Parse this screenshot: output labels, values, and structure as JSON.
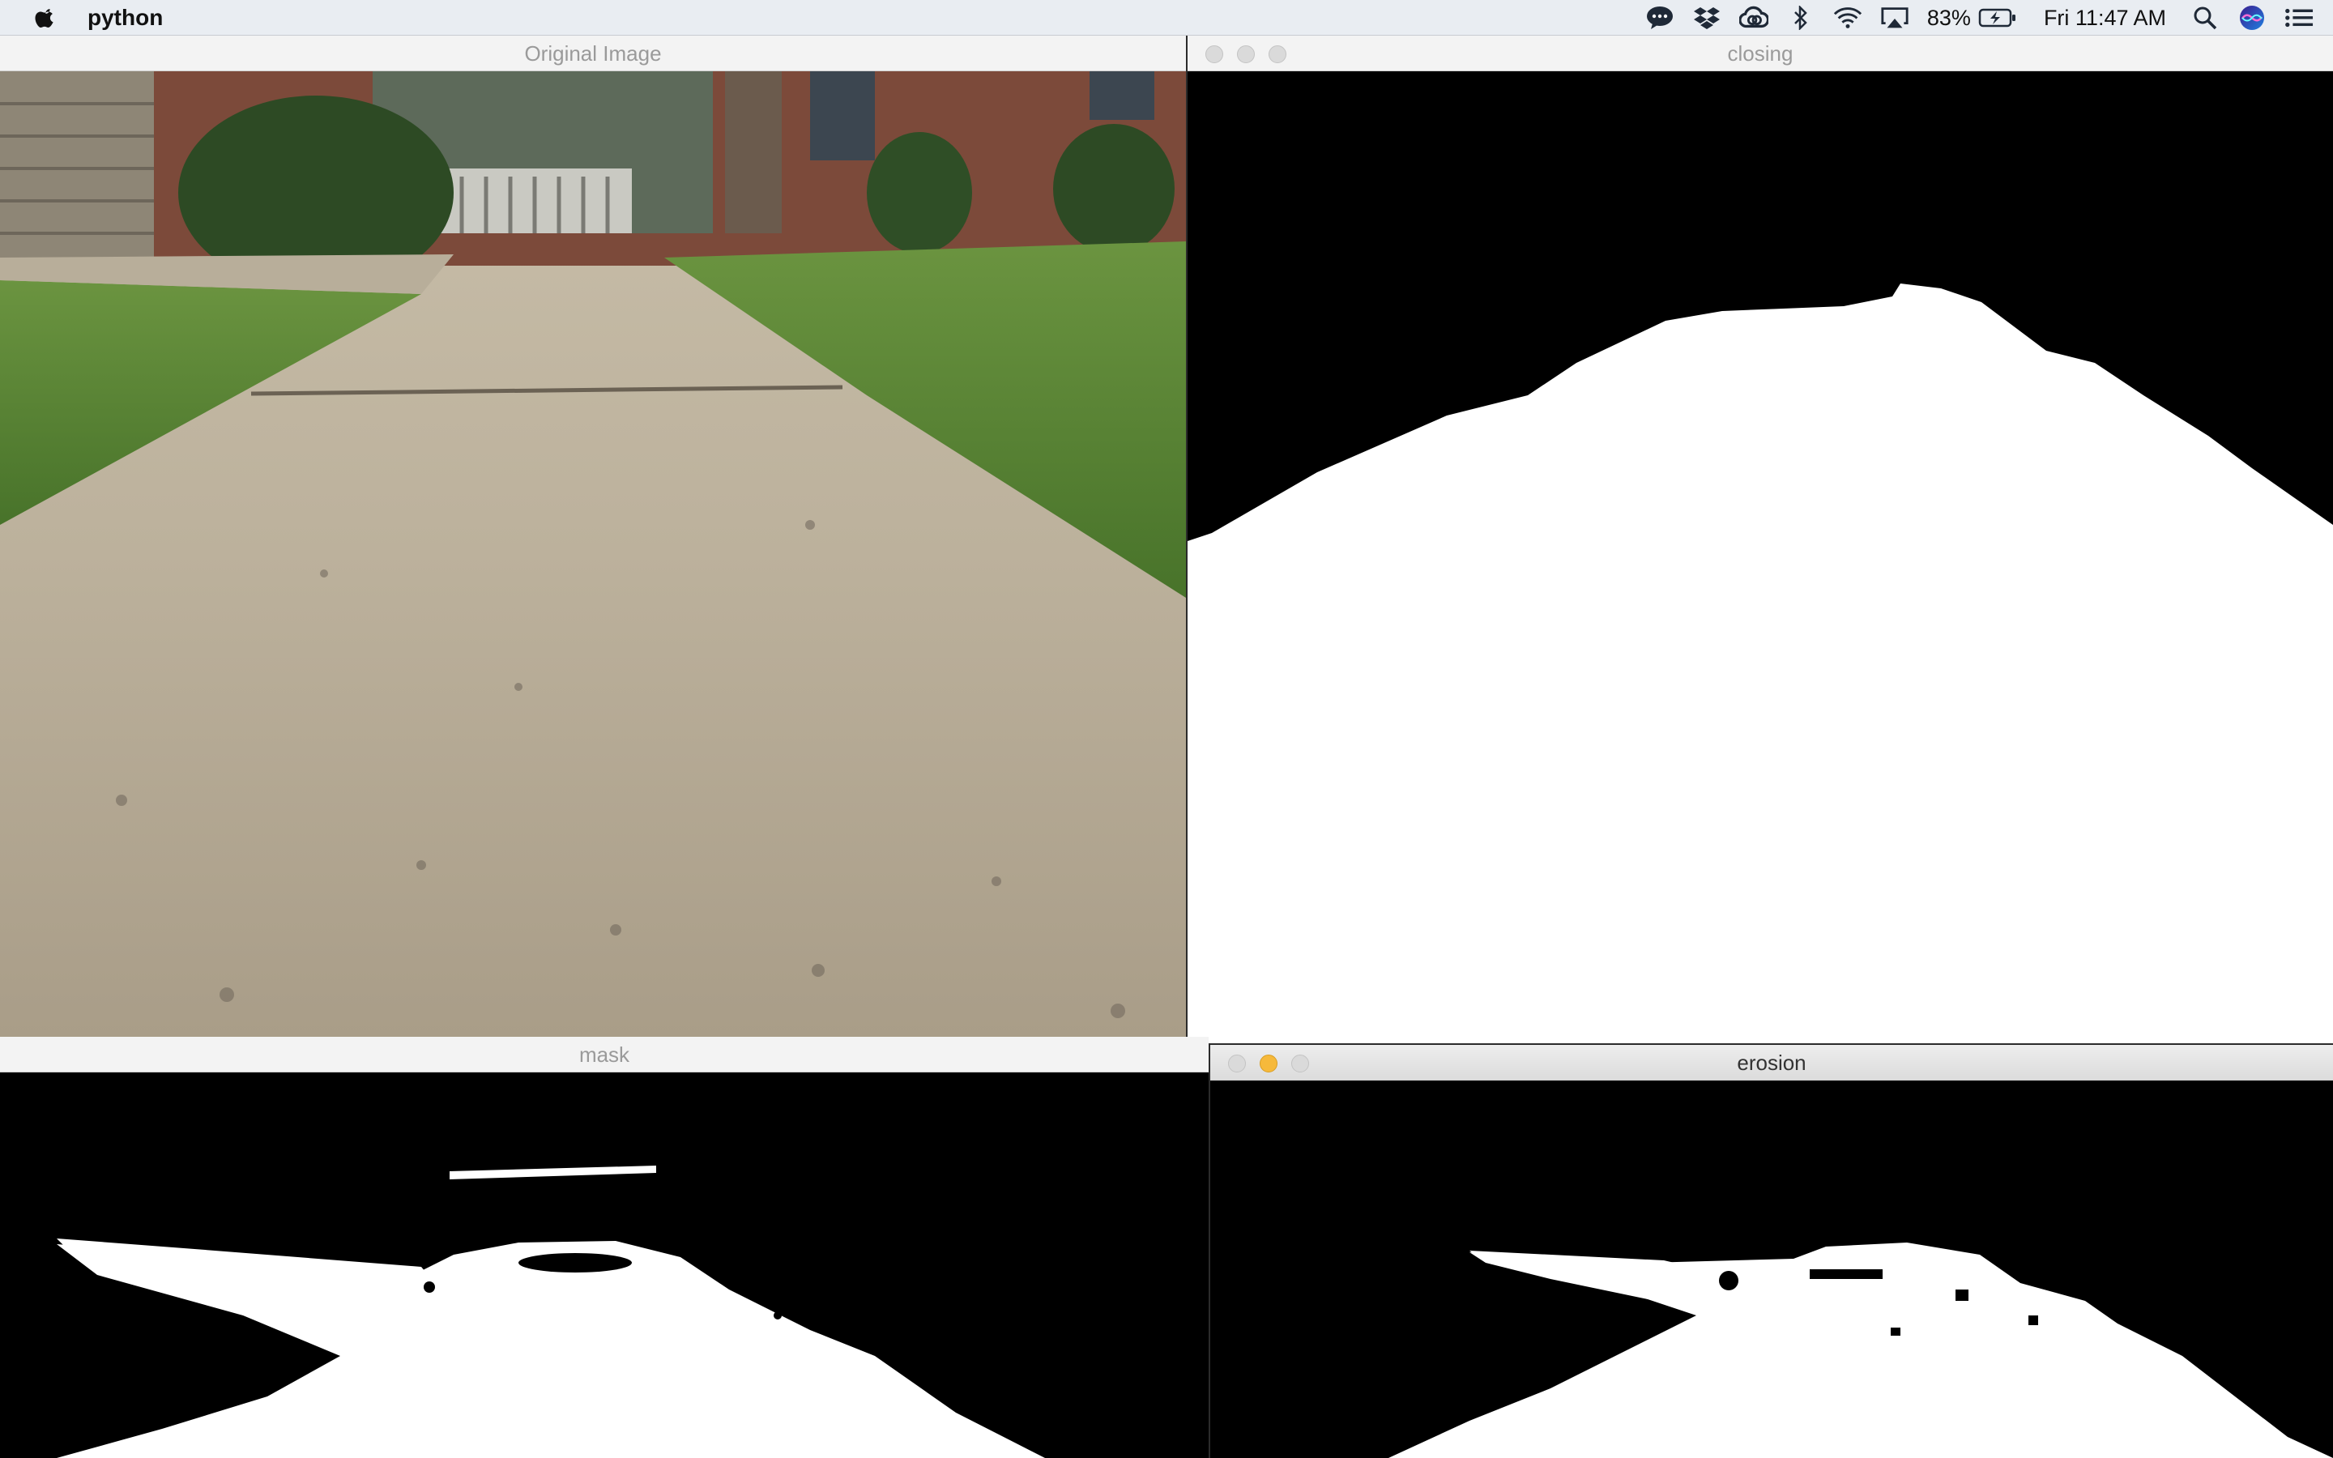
{
  "menubar": {
    "app_name": "python",
    "battery_percent": "83%",
    "clock": "Fri 11:47 AM",
    "icons": [
      "apple-icon",
      "messages-icon",
      "dropbox-icon",
      "creative-cloud-icon",
      "bluetooth-icon",
      "wifi-icon",
      "airplay-icon",
      "battery-icon",
      "spotlight-icon",
      "siri-icon",
      "notification-center-icon"
    ]
  },
  "windows": {
    "original": {
      "title": "Original Image"
    },
    "closing": {
      "title": "closing"
    },
    "mask": {
      "title": "mask"
    },
    "erosion": {
      "title": "erosion"
    }
  },
  "colors": {
    "menubar_bg": "#e9edf2",
    "mask_black": "#000000",
    "mask_white": "#ffffff",
    "grass": "#5e8a32",
    "concrete": "#b9ad98",
    "minimize_active": "#f6b93b"
  }
}
